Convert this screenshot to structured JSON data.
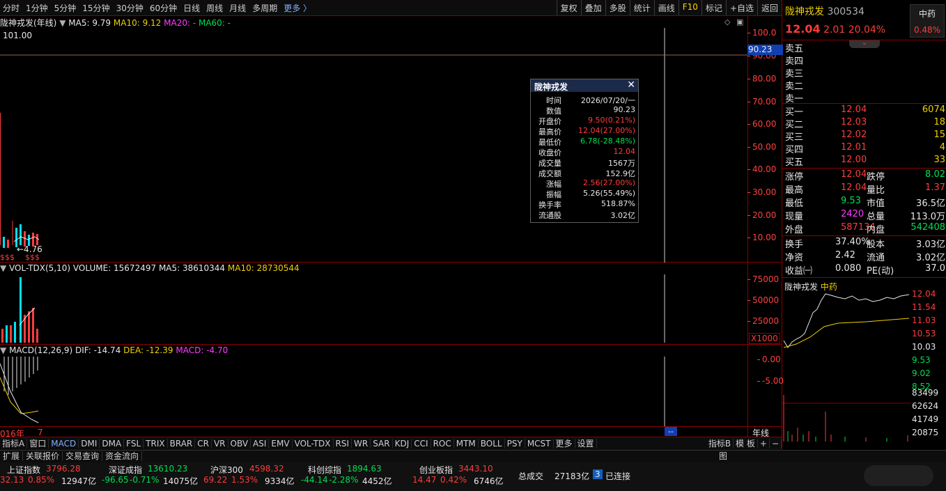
{
  "toolbar": {
    "periods": [
      "分时",
      "1分钟",
      "5分钟",
      "15分钟",
      "30分钟",
      "60分钟",
      "日线",
      "周线",
      "月线",
      "多周期"
    ],
    "more": "更多 〉",
    "right": [
      "复权",
      "叠加",
      "多股",
      "统计",
      "画线",
      "F10",
      "标记",
      "+自选",
      "返回"
    ]
  },
  "main_chart": {
    "name": "陇神戎发(年线)",
    "ma5": "MA5: 9.79",
    "ma10": "MA10: 9.12",
    "ma20": "MA20: -",
    "ma60": "MA60: -",
    "high_label": "101.00",
    "low_label": "←4.76",
    "marker_label": "$$$",
    "y_ticks": [
      "100.0",
      "90.00",
      "80.00",
      "70.00",
      "60.00",
      "50.00",
      "40.00",
      "30.00",
      "20.00",
      "10.00"
    ],
    "cursor_value": "90.23"
  },
  "volume_chart": {
    "name": "VOL-TDX(5,10)",
    "volume": "VOLUME: 15672497",
    "ma5": "MA5: 38610344",
    "ma10": "MA10: 28730544",
    "y_ticks": [
      "75000",
      "50000",
      "25000"
    ],
    "unit": "X1000"
  },
  "macd_chart": {
    "name": "MACD(12,26,9)",
    "dif": "DIF: -14.74",
    "dea": "DEA: -12.39",
    "macd": "MACD: -4.70",
    "y_ticks": [
      "0.00",
      "-5.00"
    ]
  },
  "time_axis": {
    "start": "016年",
    "tick": "7",
    "cursor": "--",
    "period": "年线"
  },
  "info_box": {
    "title": "陇神戎发",
    "rows": [
      {
        "k": "时间",
        "v": "2026/07/20/一",
        "c": "white"
      },
      {
        "k": "数值",
        "v": "90.23",
        "c": "white"
      },
      {
        "k": "开盘价",
        "v": "9.50(0.21%)",
        "c": "red"
      },
      {
        "k": "最高价",
        "v": "12.04(27.00%)",
        "c": "red"
      },
      {
        "k": "最低价",
        "v": "6.78(-28.48%)",
        "c": "green"
      },
      {
        "k": "收盘价",
        "v": "12.04",
        "c": "red"
      },
      {
        "k": "成交量",
        "v": "1567万",
        "c": "white"
      },
      {
        "k": "成交额",
        "v": "152.9亿",
        "c": "white"
      },
      {
        "k": "涨幅",
        "v": "2.56(27.00%)",
        "c": "red"
      },
      {
        "k": "振幅",
        "v": "5.26(55.49%)",
        "c": "white"
      },
      {
        "k": "换手率",
        "v": "518.87%",
        "c": "white"
      },
      {
        "k": "流通股",
        "v": "3.02亿",
        "c": "white"
      }
    ]
  },
  "quote": {
    "name": "陇神戎发",
    "code": "300534",
    "sector": "中药",
    "sector_pct": "0.48%",
    "price": "12.04",
    "change": "2.01",
    "change_pct": "20.04%",
    "asks": [
      "卖五",
      "卖四",
      "卖三",
      "卖二",
      "卖一"
    ],
    "bids": [
      {
        "l": "买一",
        "p": "12.04",
        "v": "6074"
      },
      {
        "l": "买二",
        "p": "12.03",
        "v": "18"
      },
      {
        "l": "买三",
        "p": "12.02",
        "v": "15"
      },
      {
        "l": "买四",
        "p": "12.01",
        "v": "4"
      },
      {
        "l": "买五",
        "p": "12.00",
        "v": "33"
      }
    ],
    "stats": [
      {
        "a": "涨停",
        "av": "12.04",
        "ac": "red",
        "b": "跌停",
        "bv": "8.02",
        "bc": "green"
      },
      {
        "a": "最高",
        "av": "12.04",
        "ac": "red",
        "b": "量比",
        "bv": "1.37",
        "bc": "red"
      },
      {
        "a": "最低",
        "av": "9.53",
        "ac": "green",
        "b": "市值",
        "bv": "36.5亿",
        "bc": "white"
      },
      {
        "a": "现量",
        "av": "2420",
        "ac": "mag",
        "b": "总量",
        "bv": "113.0万",
        "bc": "white"
      },
      {
        "a": "外盘",
        "av": "587134",
        "ac": "red",
        "b": "内盘",
        "bv": "542408",
        "bc": "green"
      }
    ],
    "fund": [
      {
        "a": "换手",
        "av": "37.40%",
        "b": "股本",
        "bv": "3.03亿"
      },
      {
        "a": "净资",
        "av": "2.42",
        "b": "流通",
        "bv": "3.02亿"
      },
      {
        "a": "收益㈠",
        "av": "0.080",
        "b": "PE(动)",
        "bv": "37.0"
      }
    ]
  },
  "mini_chart": {
    "name": "陇神戎发",
    "sector": "中药",
    "price_ticks": [
      "12.04",
      "11.54",
      "11.03",
      "10.53",
      "10.03",
      "9.53",
      "9.02",
      "8.52"
    ],
    "vol_ticks": [
      "83499",
      "62624",
      "41749",
      "20875"
    ]
  },
  "tabs": [
    "指标A",
    "窗口",
    "MACD",
    "DMI",
    "DMA",
    "FSL",
    "TRIX",
    "BRAR",
    "CR",
    "VR",
    "OBV",
    "ASI",
    "EMV",
    "VOL-TDX",
    "RSI",
    "WR",
    "SAR",
    "KDJ",
    "CCI",
    "ROC",
    "MTM",
    "BOLL",
    "PSY",
    "MCST",
    "更多",
    "设置"
  ],
  "tabs_right": [
    "指标B",
    "模 板",
    "+",
    "−"
  ],
  "row2": [
    "扩展",
    "关联报价",
    "交易查询",
    "资金流向"
  ],
  "row2_right": "图",
  "indices": [
    {
      "name": "上证指数",
      "val": "3796.28",
      "chg": "32.13",
      "pct": "0.85%",
      "amt": "12947亿",
      "c": "red"
    },
    {
      "name": "深证成指",
      "val": "13610.23",
      "chg": "-96.65",
      "pct": "-0.71%",
      "amt": "14075亿",
      "c": "green"
    },
    {
      "name": "沪深300",
      "val": "4598.32",
      "chg": "69.22",
      "pct": "1.53%",
      "amt": "9334亿",
      "c": "red"
    },
    {
      "name": "科创综指",
      "val": "1894.63",
      "chg": "-44.14",
      "pct": "-2.28%",
      "amt": "4452亿",
      "c": "green"
    },
    {
      "name": "创业板指",
      "val": "3443.10",
      "chg": "14.47",
      "pct": "0.42%",
      "amt": "6746亿",
      "c": "red"
    }
  ],
  "total": {
    "label": "总成交",
    "value": "27183亿"
  },
  "connection": {
    "count": "3",
    "label": "已连接"
  }
}
